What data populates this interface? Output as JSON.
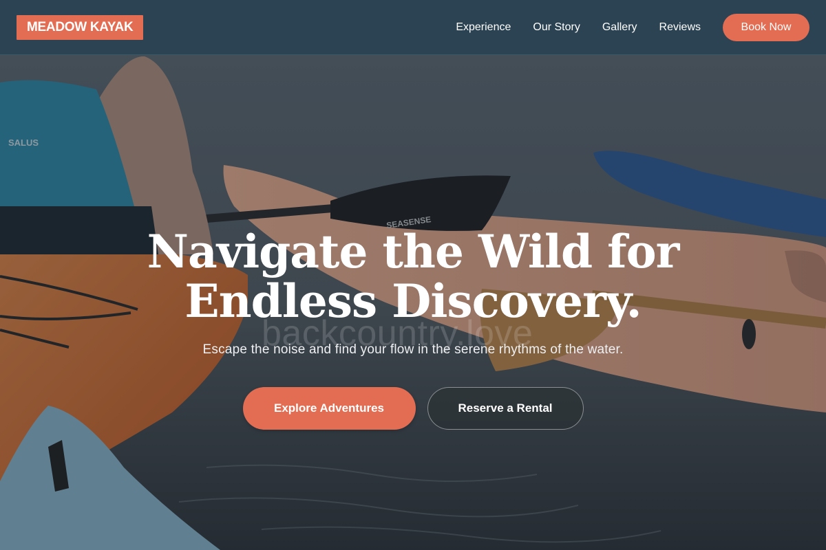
{
  "brand": {
    "logo_text": "MEADOW KAYAK"
  },
  "nav": {
    "links": [
      "Experience",
      "Our Story",
      "Gallery",
      "Reviews"
    ],
    "cta_label": "Book Now"
  },
  "hero": {
    "headline_line1": "Navigate the Wild for",
    "headline_line2": "Endless Discovery.",
    "subheadline": "Escape the noise and find your flow in the serene rhythms of the water.",
    "primary_cta": "Explore Adventures",
    "secondary_cta": "Reserve a Rental",
    "watermark_text": "backcountry.love",
    "photo_text": {
      "vest_brand": "SALUS",
      "paddle_brand": "SEASENSE"
    }
  },
  "colors": {
    "accent": "#e36d53",
    "nav_background": "#2b4352",
    "text_light": "#ffffff"
  }
}
